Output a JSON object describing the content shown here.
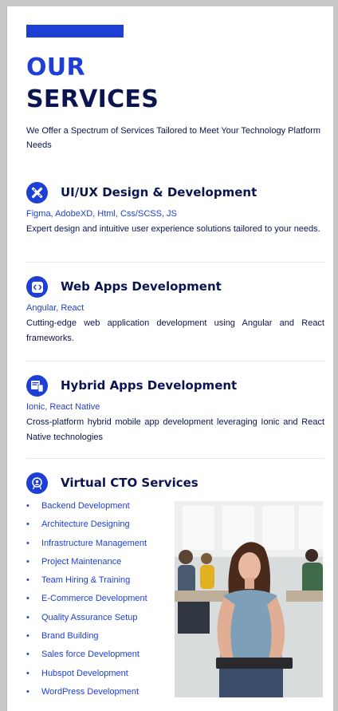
{
  "heading": {
    "line1": "OUR",
    "line2": "SERVICES"
  },
  "intro": "We Offer a Spectrum of Services Tailored to Meet Your Technology Platform Needs",
  "services": [
    {
      "title": "UI/UX Design & Development",
      "tech": "Figma, AdobeXD, Html, Css/SCSS, JS",
      "desc": "Expert design and intuitive user experience solutions tailored to your needs.",
      "icon": "design-tools-icon"
    },
    {
      "title": "Web Apps Development",
      "tech": "Angular, React",
      "desc": "Cutting-edge web application development using Angular and React frameworks.",
      "icon": "code-window-icon"
    },
    {
      "title": "Hybrid Apps Development",
      "tech": "Ionic, React Native",
      "desc": "Cross-platform hybrid mobile app development leveraging Ionic and React Native technologies",
      "icon": "devices-icon"
    }
  ],
  "cto": {
    "title": "Virtual CTO Services",
    "icon": "cto-badge-icon",
    "items": [
      "Backend Development",
      "Architecture Designing",
      "Infrastructure Management",
      "Project Maintenance",
      "Team Hiring & Training",
      "E-Commerce Development",
      "Quality Assurance Setup",
      "Brand Building",
      "Sales force Development",
      "Hubspot Development",
      "WordPress Development"
    ]
  },
  "bullet": "•",
  "colors": {
    "accent": "#1e3fd6",
    "navy": "#0c1450",
    "background": "#ffffff"
  }
}
